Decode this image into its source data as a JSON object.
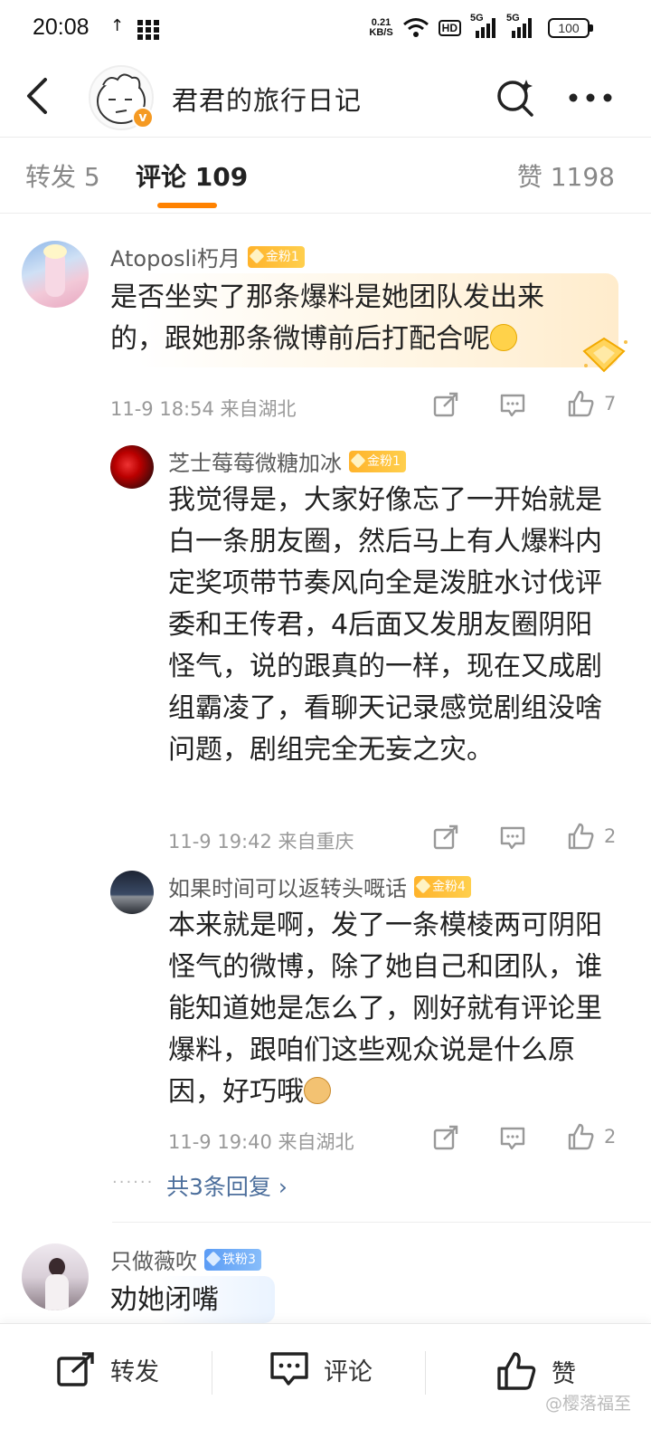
{
  "status_bar": {
    "time": "20:08",
    "net_speed_value": "0.21",
    "net_speed_unit": "KB/S",
    "hd_label": "HD",
    "signal1_label": "5G",
    "signal2_label": "5G",
    "battery": "100"
  },
  "header": {
    "title": "君君的旅行日记",
    "verified_mark": "v"
  },
  "tabs": {
    "repost": "转发 5",
    "comment": "评论 109",
    "like": "赞 1198"
  },
  "comments": [
    {
      "username": "Atoposli朽月",
      "badge": "金粉1",
      "text": "是否坐实了那条爆料是她团队发出来的，跟她那条微博前后打配合呢",
      "time_location": "11-9 18:54 来自湖北",
      "likes": "7",
      "replies": [
        {
          "username": "芝士莓莓微糖加冰",
          "badge": "金粉1",
          "text": "我觉得是，大家好像忘了一开始就是白一条朋友圈，然后马上有人爆料内定奖项带节奏风向全是泼脏水讨伐评委和王传君，4后面又发朋友圈阴阳怪气，说的跟真的一样，现在又成剧组霸凌了，看聊天记录感觉剧组没啥问题，剧组完全无妄之灾。",
          "time_location": "11-9 19:42 来自重庆",
          "likes": "2"
        },
        {
          "username": "如果时间可以返转头嘅话",
          "badge": "金粉4",
          "text": "本来就是啊，发了一条模棱两可阴阳怪气的微博，除了她自己和团队，谁能知道她是怎么了，刚好就有评论里爆料，跟咱们这些观众说是什么原因，好巧哦",
          "time_location": "11-9 19:40 来自湖北",
          "likes": "2"
        }
      ],
      "more_replies": "共3条回复 ›"
    },
    {
      "username": "只做薇吹",
      "badge": "铁粉3",
      "text": "劝她闭嘴"
    }
  ],
  "bottom_bar": {
    "repost": "转发",
    "comment": "评论",
    "like": "赞"
  },
  "watermark": "@樱落福至",
  "colors": {
    "accent": "#ff8200",
    "link": "#4d6f9c",
    "gold_badge": "#ffb32b",
    "iron_badge": "#5b9cf5"
  }
}
